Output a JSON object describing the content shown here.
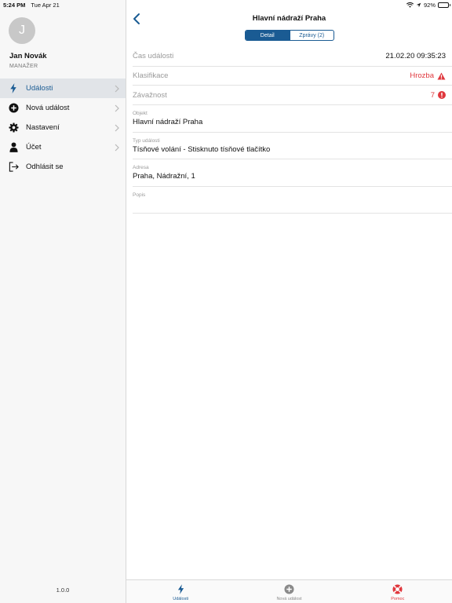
{
  "status_bar": {
    "time": "5:24 PM",
    "date": "Tue Apr 21",
    "battery": "92%",
    "battery_level": 0.92
  },
  "sidebar": {
    "avatar_initial": "J",
    "user_name": "Jan Novák",
    "user_role": "MANAŽER",
    "items": [
      {
        "label": "Události",
        "icon": "bolt-icon",
        "active": true,
        "chevron": true
      },
      {
        "label": "Nová událost",
        "icon": "plus-circle-icon",
        "active": false,
        "chevron": true
      },
      {
        "label": "Nastavení",
        "icon": "gear-icon",
        "active": false,
        "chevron": true
      },
      {
        "label": "Účet",
        "icon": "person-icon",
        "active": false,
        "chevron": true
      },
      {
        "label": "Odhlásit se",
        "icon": "logout-icon",
        "active": false,
        "chevron": false
      }
    ],
    "version": "1.0.0"
  },
  "header": {
    "title": "Hlavní nádraží Praha",
    "tabs": [
      {
        "label": "Detail",
        "active": true
      },
      {
        "label": "Zprávy (2)",
        "active": false
      }
    ]
  },
  "details": {
    "time": {
      "label": "Čas události",
      "value": "21.02.20 09:35:23"
    },
    "classification": {
      "label": "Klasifikace",
      "value": "Hrozba"
    },
    "severity": {
      "label": "Závažnost",
      "value": "7"
    },
    "object": {
      "label": "Objekt",
      "value": "Hlavní nádraží Praha"
    },
    "type": {
      "label": "Typ události",
      "value": "Tísňové volání - Stisknuto tísňové tlačítko"
    },
    "address": {
      "label": "Adresa",
      "value": "Praha, Nádražní, 1"
    },
    "description": {
      "label": "Popis",
      "value": ""
    }
  },
  "tab_bar": [
    {
      "label": "Události",
      "icon": "bolt-icon",
      "color": "#1a5b93"
    },
    {
      "label": "Nová událost",
      "icon": "plus-circle-icon",
      "color": "#8a8a8a"
    },
    {
      "label": "Pomoc",
      "icon": "lifebuoy-icon",
      "color": "#e0373d"
    }
  ],
  "colors": {
    "accent": "#1a5b93",
    "danger": "#e0373d",
    "active_row": "#e1e4e8"
  }
}
